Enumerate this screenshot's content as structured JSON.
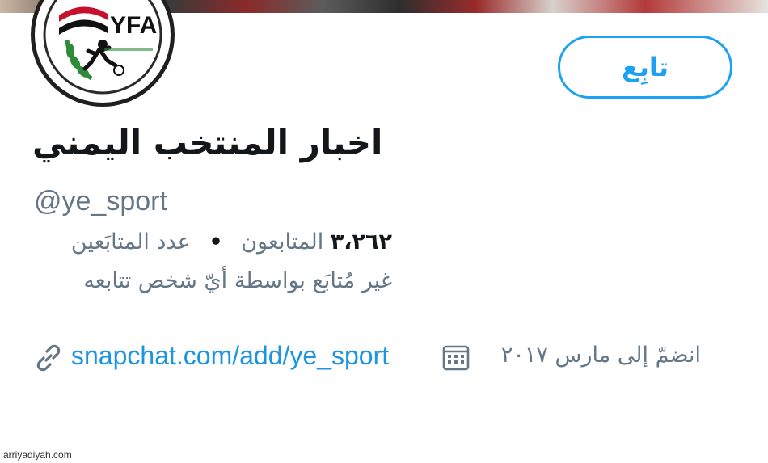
{
  "profile": {
    "logo_text": "YFA",
    "follow_label": "تابِع",
    "display_name": "اخبار المنتخب اليمني",
    "handle": "@ye_sport",
    "followers_count": "٣،٢٦٢",
    "followers_label": "المتابعون",
    "followers_separator": "•",
    "followers_count_label": "عدد المتابَعين",
    "follow_note": "غير مُتابَع بواسطة أيّ شخص تتابعه",
    "website": "snapchat.com/add/ye_sport",
    "joined": "انضمّ إلى مارس ٢٠١٧"
  },
  "icons": {
    "link": "link-icon",
    "calendar": "calendar-icon"
  },
  "watermark": "arriyadiyah.com",
  "colors": {
    "accent": "#1da1f2",
    "link": "#1b95e0",
    "secondary_text": "#657786",
    "primary_text": "#14171a"
  }
}
